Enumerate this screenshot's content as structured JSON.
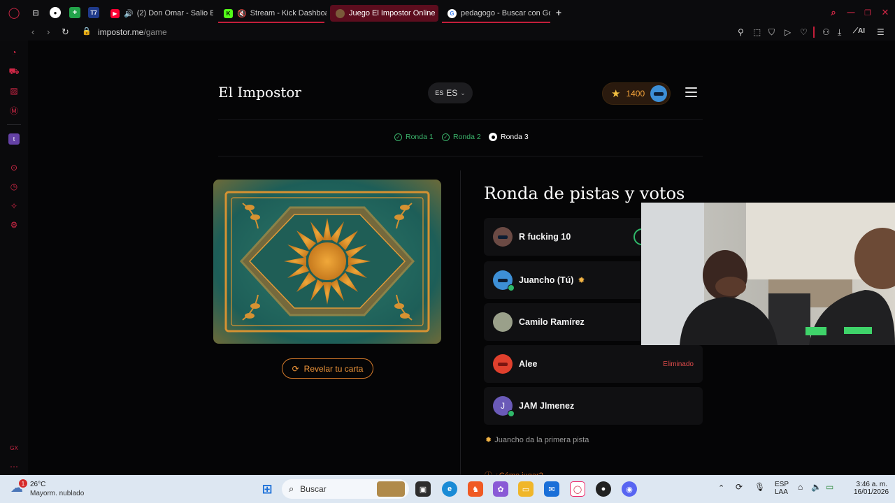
{
  "browser": {
    "tabs": [
      {
        "label": "(2) Don Omar - Salio E",
        "color": "#ff0033"
      },
      {
        "label": "Stream - Kick Dashboa",
        "color": "#53fc18"
      },
      {
        "label": "Juego El Impostor Online",
        "color": "#7a5a3a",
        "active": true
      },
      {
        "label": "pedagogo - Buscar con Go",
        "color": "#4285f4"
      }
    ],
    "pinned": [
      "T7"
    ],
    "url_host": "impostor.me",
    "url_path": "/game",
    "ai_label": "AI"
  },
  "sidebar": {
    "bottom_label": "GX"
  },
  "header": {
    "logo": "El Impostor",
    "lang_flag": "ES",
    "lang_code": "ES",
    "points": "1400"
  },
  "rounds": [
    {
      "label": "Ronda 1",
      "state": "done"
    },
    {
      "label": "Ronda 2",
      "state": "done"
    },
    {
      "label": "Ronda 3",
      "state": "current"
    }
  ],
  "card": {
    "reveal_label": "Revelar tu carta"
  },
  "panel": {
    "title": "Ronda de pistas y votos",
    "players": [
      {
        "name": "R fucking 10",
        "avatar_color": "#6b4a44",
        "ready": false,
        "badge": "",
        "status": ""
      },
      {
        "name": "Juancho (Tú)",
        "avatar_color": "#3d8fd6",
        "ready": true,
        "badge": "sun",
        "status": ""
      },
      {
        "name": "Camilo Ramírez",
        "avatar_color": "#9aa08a",
        "ready": false,
        "badge": "",
        "status": ""
      },
      {
        "name": "Alee",
        "avatar_color": "#e0402d",
        "ready": false,
        "badge": "",
        "status": "Eliminado"
      },
      {
        "name": "JAM JImenez",
        "avatar_color": "#6a5ab8",
        "initial": "J",
        "ready": true,
        "badge": "",
        "status": ""
      }
    ],
    "hint": "Juancho da la primera pista",
    "howto": "¿Cómo jugar?"
  },
  "taskbar": {
    "weather_temp": "26°C",
    "weather_desc": "Mayorm. nublado",
    "weather_badge": "1",
    "search_placeholder": "Buscar",
    "lang_top": "ESP",
    "lang_bottom": "LAA",
    "time": "3:46 a. m.",
    "date": "16/01/2026"
  }
}
